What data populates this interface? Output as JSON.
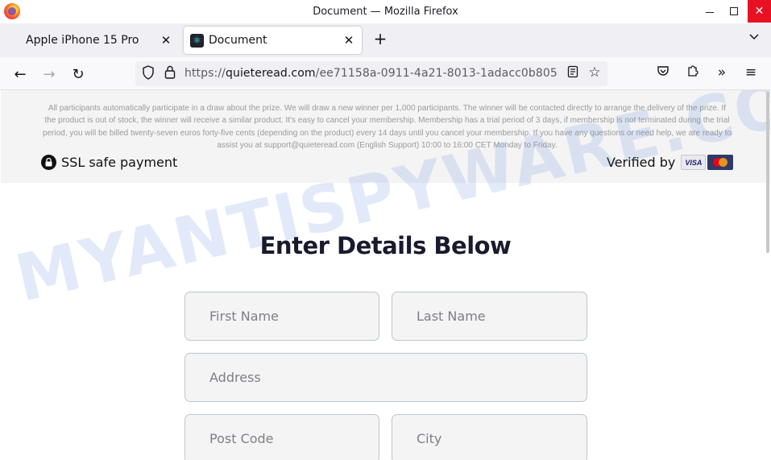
{
  "window": {
    "title": "Document — Mozilla Firefox",
    "logo_icon": "firefox-logo",
    "minimize_icon": "minimize-icon",
    "maximize_icon": "maximize-icon",
    "close_glyph": "✕"
  },
  "tabs": [
    {
      "label": "Apple iPhone 15 Pro",
      "active": false,
      "close_glyph": "✕"
    },
    {
      "label": "Document",
      "active": true,
      "favicon": "react-icon",
      "close_glyph": "✕"
    }
  ],
  "tabstrip": {
    "new_tab_glyph": "+",
    "list_glyph": "⌄"
  },
  "navbar": {
    "back_glyph": "←",
    "forward_glyph": "→",
    "reload_glyph": "↻",
    "url_scheme": "https://",
    "url_domain": "quieteread.com",
    "url_path": "/ee71158a-0911-4a21-8013-1adacc0b805",
    "star_glyph": "☆",
    "more_glyph": "»",
    "menu_glyph": "≡"
  },
  "page": {
    "disclaimer": "All participants automatically participate in a draw about the prize. We will draw a new winner per 1,000 participants. The winner will be contacted directly to arrange the delivery of the prize. If the product is out of stock, the winner will receive a similar product. It's easy to cancel your membership. Membership has a trial period of 3 days, if membership is not terminated during the trial period, you will be billed twenty-seven euros forty-five cents (depending on the product) every 14 days until you cancel your membership. If you have any questions or need help, we are ready to assist you at support@quieteread.com (English Support) 10:00 to 16:00 CET Monday to Friday.",
    "ssl_label": "SSL safe payment",
    "verified_label": "Verified by",
    "visa_label": "VISA",
    "form_title": "Enter Details Below",
    "fields": {
      "first_name": {
        "placeholder": "First Name",
        "value": ""
      },
      "last_name": {
        "placeholder": "Last Name",
        "value": ""
      },
      "address": {
        "placeholder": "Address",
        "value": ""
      },
      "post_code": {
        "placeholder": "Post Code",
        "value": ""
      },
      "city": {
        "placeholder": "City",
        "value": ""
      }
    },
    "watermark": "MYANTISPYWARE.COM"
  },
  "colors": {
    "close_button": "#e81123",
    "title_text": "#1a1a2e",
    "field_border": "#bcc6cf",
    "disclaimer_bg": "#f4f4f4"
  }
}
